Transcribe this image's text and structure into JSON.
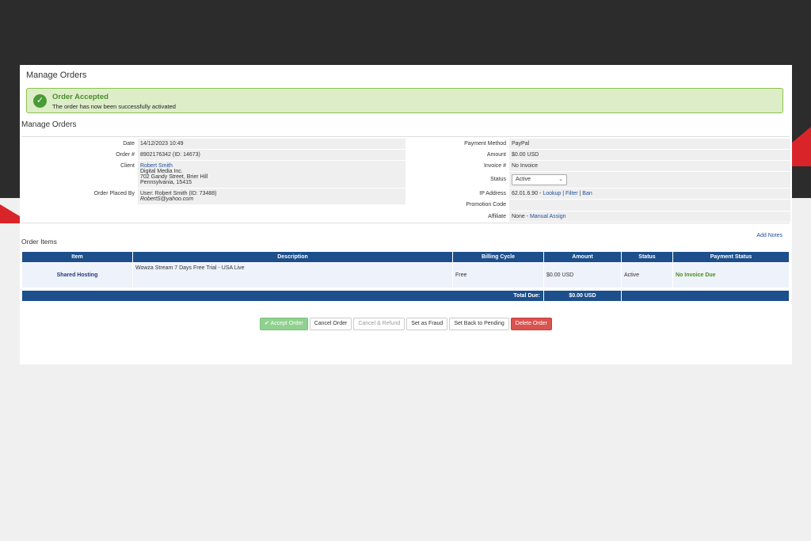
{
  "page": {
    "title": "Manage Orders",
    "subtitle": "Manage Orders"
  },
  "alert": {
    "title": "Order Accepted",
    "message": "The order has now been successfully activated"
  },
  "details_left": [
    {
      "label": "Date",
      "lines": [
        "14/12/2023 10:49"
      ]
    },
    {
      "label": "Order #",
      "lines": [
        "8902176342 (ID: 14673)"
      ]
    },
    {
      "label": "Client",
      "client_name": "Robert Smith",
      "lines": [
        "Digital Media Inc.",
        "702 Gandy Street, Brier Hill",
        "Pennsylvania, 15415"
      ]
    },
    {
      "label": "Order Placed By",
      "lines": [
        "User: Robert Smith (ID: 73488)"
      ],
      "email": "RobertS@yahoo.com"
    }
  ],
  "details_right": {
    "payment_method": {
      "label": "Payment Method",
      "value": "PayPal"
    },
    "amount": {
      "label": "Amount",
      "value": "$0.00 USD"
    },
    "invoice": {
      "label": "Invoice #",
      "value": "No Invoice"
    },
    "status": {
      "label": "Status",
      "value": "Active"
    },
    "ip": {
      "label": "IP Address",
      "value": "62.01.6.90 - ",
      "lookup": "Lookup",
      "sep1": " | ",
      "filter": "Filter",
      "sep2": " | ",
      "ban": "Ban"
    },
    "promo": {
      "label": "Promotion Code",
      "value": ""
    },
    "affiliate": {
      "label": "Affiliate",
      "value": "None - ",
      "assign": "Manual Assign"
    }
  },
  "order_items": {
    "title": "Order Items",
    "add_notes": "Add Notes",
    "headers": [
      "Item",
      "Description",
      "Billing Cycle",
      "Amount",
      "Status",
      "Payment Status"
    ],
    "row": {
      "item": "Shared Hosting",
      "description": "Wowza Stream 7 Days Free Trial - USA Live",
      "billing_cycle": "Free",
      "amount": "$0.00 USD",
      "status": "Active",
      "payment_status": "No Invoice Due"
    },
    "total_label": "Total Due:",
    "total_value": "$0.00 USD"
  },
  "buttons": {
    "accept": "Accept Order",
    "cancel": "Cancel Order",
    "cancel_refund": "Cancel & Refund",
    "fraud": "Set as Fraud",
    "pending": "Set Back to Pending",
    "delete": "Delete Order"
  },
  "icons": {
    "alert": "check-circle-icon",
    "select": "chevron-down-icon"
  },
  "colors": {
    "header_blue": "#1c4f8b",
    "alert_green": "#dcedc8",
    "delete_red": "#d9534f",
    "accept_green": "#8fd18f"
  }
}
